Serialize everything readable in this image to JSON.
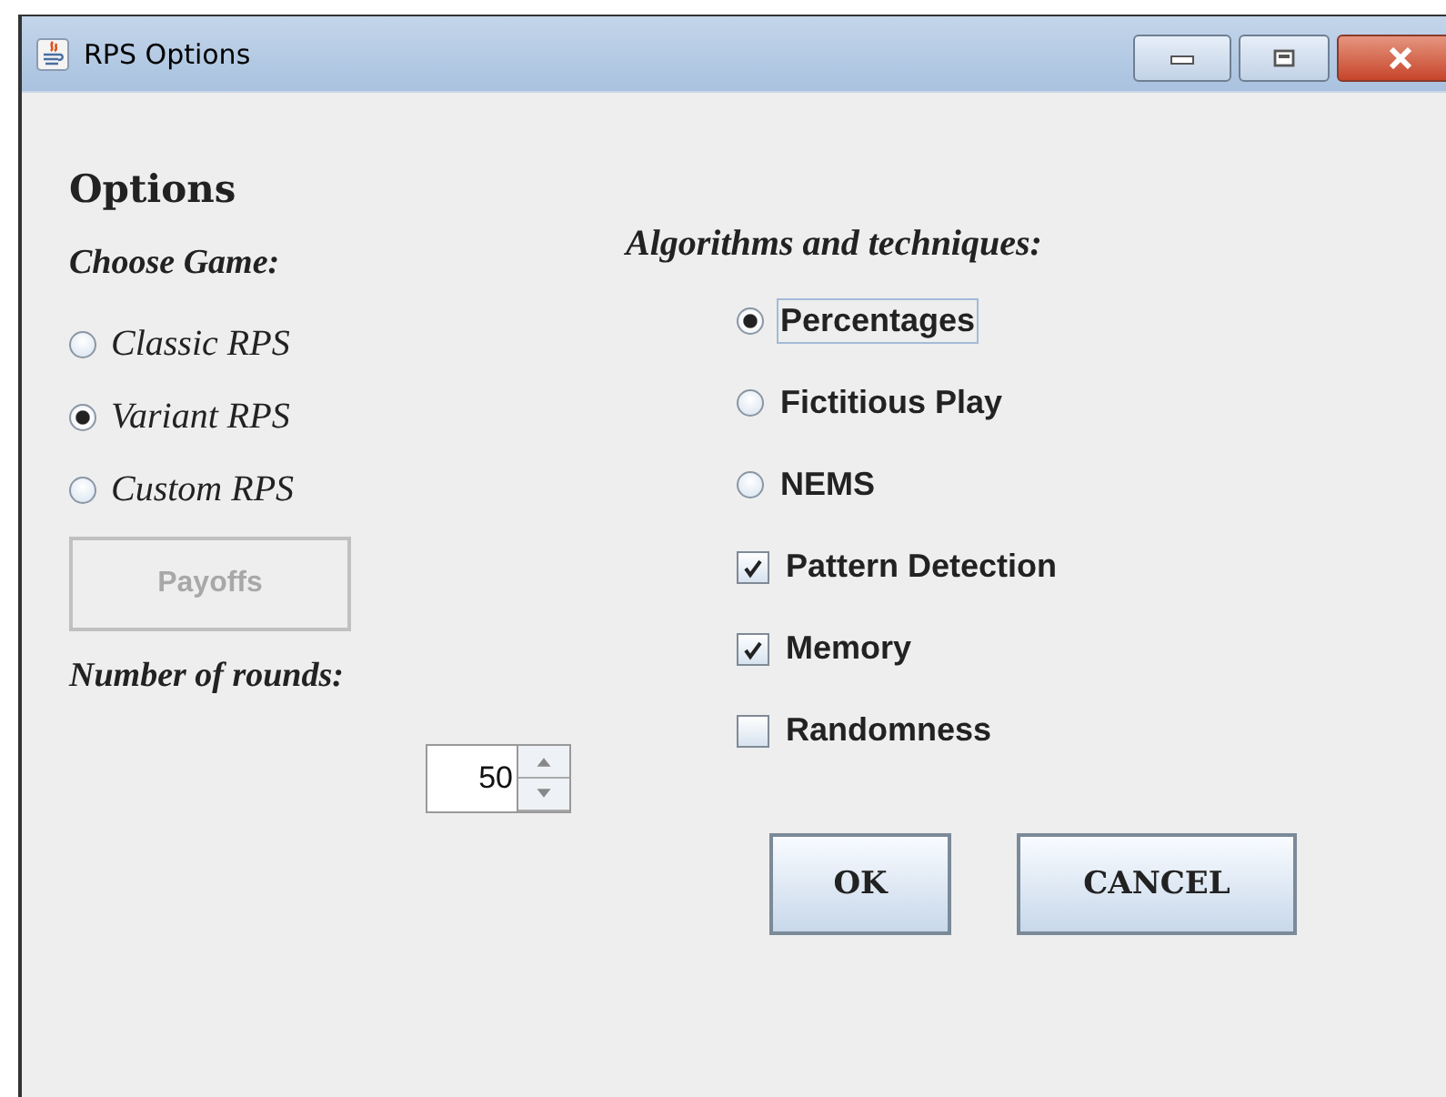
{
  "window": {
    "title": "RPS Options"
  },
  "heading": "Options",
  "game": {
    "label": "Choose Game:",
    "options": [
      {
        "label": "Classic RPS",
        "selected": false
      },
      {
        "label": "Variant RPS",
        "selected": true
      },
      {
        "label": "Custom RPS",
        "selected": false
      }
    ]
  },
  "payoffs_button": {
    "label": "Payoffs",
    "disabled": true
  },
  "rounds": {
    "label": "Number of rounds:",
    "value": "50"
  },
  "algorithms": {
    "label": "Algorithms and techniques:",
    "items": [
      {
        "kind": "radio",
        "label": "Percentages",
        "selected": true,
        "focused": true
      },
      {
        "kind": "radio",
        "label": "Fictitious Play",
        "selected": false,
        "focused": false
      },
      {
        "kind": "radio",
        "label": "NEMS",
        "selected": false,
        "focused": false
      },
      {
        "kind": "checkbox",
        "label": "Pattern Detection",
        "checked": true,
        "focused": false
      },
      {
        "kind": "checkbox",
        "label": "Memory",
        "checked": true,
        "focused": false
      },
      {
        "kind": "checkbox",
        "label": "Randomness",
        "checked": false,
        "focused": false
      }
    ]
  },
  "buttons": [
    "OK",
    "CANCEL"
  ]
}
